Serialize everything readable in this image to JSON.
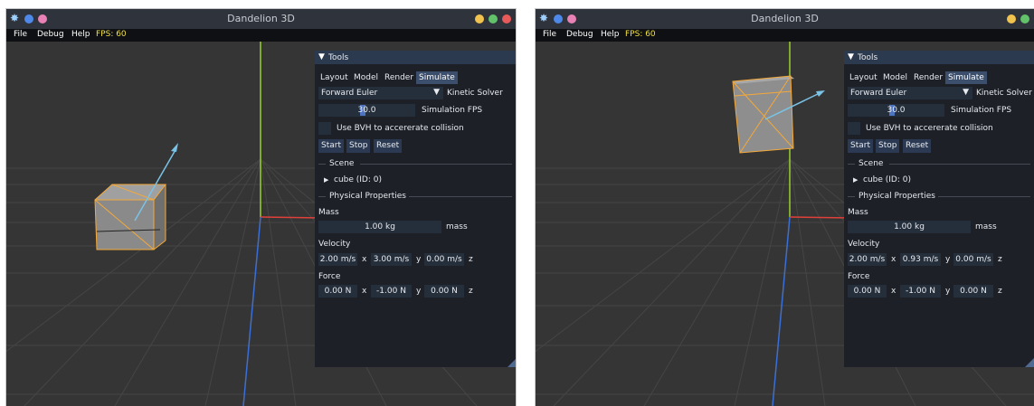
{
  "left": {
    "app_title": "Dandelion 3D",
    "menu": [
      "File",
      "Debug",
      "Help"
    ],
    "fps_label": "FPS: 60",
    "tools": {
      "title": "Tools",
      "tabs": [
        "Layout",
        "Model",
        "Render",
        "Simulate"
      ],
      "solver_value": "Forward Euler",
      "solver_label": "Kinetic Solver",
      "sim_fps_value": "30.0",
      "sim_fps_label": "Simulation FPS",
      "bvh_label": "Use BVH to accererate collision",
      "buttons": [
        "Start",
        "Stop",
        "Reset"
      ],
      "scene_label": "Scene",
      "scene_item": "cube (ID: 0)",
      "phys_label": "Physical Properties",
      "mass_label": "Mass",
      "mass_value": "1.00 kg",
      "mass_unit": "mass",
      "velocity_label": "Velocity",
      "velocity": [
        "2.00 m/s",
        "3.00 m/s",
        "0.00 m/s"
      ],
      "force_label": "Force",
      "force": [
        "0.00 N",
        "-1.00 N",
        "0.00 N"
      ],
      "axes": [
        "x",
        "y",
        "z"
      ]
    }
  },
  "right": {
    "app_title": "Dandelion 3D",
    "menu": [
      "File",
      "Debug",
      "Help"
    ],
    "fps_label": "FPS: 60",
    "tools": {
      "title": "Tools",
      "tabs": [
        "Layout",
        "Model",
        "Render",
        "Simulate"
      ],
      "solver_value": "Forward Euler",
      "solver_label": "Kinetic Solver",
      "sim_fps_value": "30.0",
      "sim_fps_label": "Simulation FPS",
      "bvh_label": "Use BVH to accererate collision",
      "buttons": [
        "Start",
        "Stop",
        "Reset"
      ],
      "scene_label": "Scene",
      "scene_item": "cube (ID: 0)",
      "phys_label": "Physical Properties",
      "mass_label": "Mass",
      "mass_value": "1.00 kg",
      "mass_unit": "mass",
      "velocity_label": "Velocity",
      "velocity": [
        "2.00 m/s",
        "0.93 m/s",
        "0.00 m/s"
      ],
      "force_label": "Force",
      "force": [
        "0.00 N",
        "-1.00 N",
        "0.00 N"
      ],
      "axes": [
        "x",
        "y",
        "z"
      ]
    }
  },
  "colors": {
    "fps": "#f0e040",
    "active_tab": "#3b4e6b",
    "axis_x": "#e0403a",
    "axis_y": "#9ad22b",
    "axis_z": "#3a6fd8",
    "cube_edge": "#f4a93a",
    "arrow": "#7ac2e6",
    "dot_blue": "#4e88e8",
    "dot_pink": "#e882b6",
    "dot_yellow": "#f0c24e",
    "dot_green": "#62c26a",
    "dot_red": "#e85a5a"
  }
}
